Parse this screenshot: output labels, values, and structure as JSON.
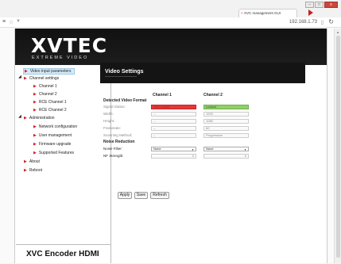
{
  "browser": {
    "tab_title": "XVC management GUI",
    "tab_close": "×",
    "url": "192.168.1.73",
    "minimize": "–",
    "maximize": "□",
    "close": "x",
    "menu_glyph": "≡",
    "star_glyph": "☆",
    "funnel_glyph": "▼",
    "page_glyph": "▯",
    "reload_glyph": "↻",
    "scroll_up_glyph": "▲"
  },
  "header": {
    "logo": "XVTEC",
    "tagline": "EXTREME VIDEO"
  },
  "sidebar": {
    "items": [
      {
        "label": "Video input parameters"
      },
      {
        "label": "Channel settings"
      },
      {
        "label": "Channel 1"
      },
      {
        "label": "Channel 2"
      },
      {
        "label": "RCE Channel 1"
      },
      {
        "label": "RCE Channel 2"
      },
      {
        "label": "Administration"
      },
      {
        "label": "Network configuration"
      },
      {
        "label": "User management"
      },
      {
        "label": "Firmware upgrade"
      },
      {
        "label": "Supported Features"
      },
      {
        "label": "About"
      },
      {
        "label": "Reboot"
      }
    ],
    "footer": "XVC Encoder HDMI",
    "tri_glyph": "▶",
    "expand_glyph": "◢"
  },
  "main": {
    "title": "Video Settings",
    "col1": "Channel 1",
    "col2": "Channel 2",
    "detected_header": "Detected Video Format",
    "rows": [
      {
        "label": "Signal Status:",
        "ch1": "Not Locked",
        "ch2": "Locked"
      },
      {
        "label": "Width:",
        "ch1": "--",
        "ch2": "1920"
      },
      {
        "label": "Height:",
        "ch1": "--",
        "ch2": "1080"
      },
      {
        "label": "Framerate:",
        "ch1": "--",
        "ch2": "60"
      },
      {
        "label": "Scanning Method:",
        "ch1": "--",
        "ch2": "Progressive"
      }
    ],
    "noise_header": "Noise Reduction",
    "noise_filter_label": "Noise Filter:",
    "noise_filter_ch1": "None",
    "noise_filter_ch2": "None",
    "nf_strength_label": "NF Strength:",
    "nf_strength_ch1": "0",
    "nf_strength_ch2": "0",
    "select_arrow": "▼",
    "buttons": {
      "apply": "Apply",
      "save": "Save",
      "refresh": "Refresh"
    }
  },
  "colors": {
    "not_locked": "#e13a3a",
    "locked": "#8fd068",
    "accent": "#d4202a"
  }
}
